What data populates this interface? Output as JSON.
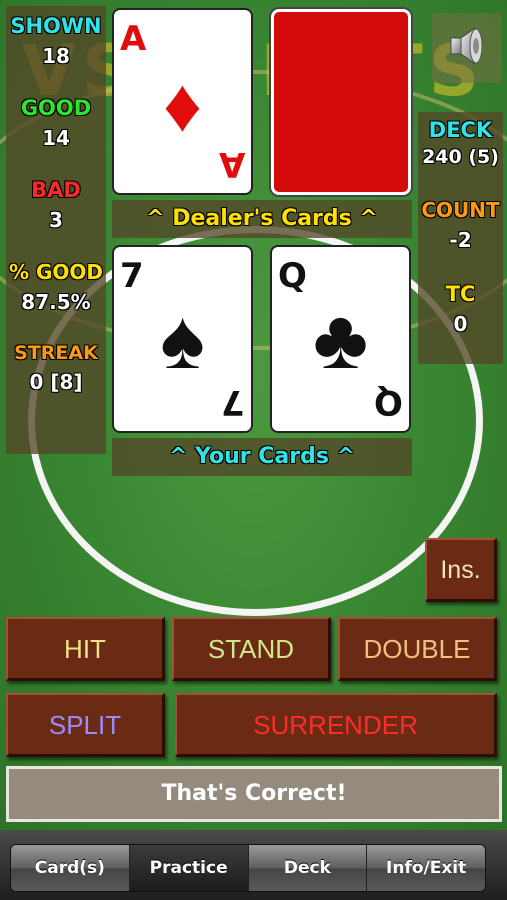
{
  "stats": {
    "shown": {
      "label": "SHOWN",
      "value": "18"
    },
    "good": {
      "label": "GOOD",
      "value": "14"
    },
    "bad": {
      "label": "BAD",
      "value": "3"
    },
    "pct_good": {
      "label": "% GOOD",
      "value": "87.5%"
    },
    "streak": {
      "label": "STREAK",
      "value": "0 [8]"
    }
  },
  "counts": {
    "deck": {
      "label": "DECK",
      "value": "240 (5)"
    },
    "count": {
      "label": "COUNT",
      "value": "-2"
    },
    "tc": {
      "label": "TC",
      "value": "0"
    }
  },
  "dealer": {
    "label": "^  Dealer's Cards  ^",
    "up_card": {
      "rank": "A",
      "suit": "♦",
      "color": "#e10d0d"
    },
    "hole_card": {
      "face": "down",
      "back_color": "#d40b0b"
    }
  },
  "player": {
    "label": "^  Your Cards  ^",
    "cards": [
      {
        "rank": "7",
        "suit": "♠",
        "color": "#111111"
      },
      {
        "rank": "Q",
        "suit": "♣",
        "color": "#111111"
      }
    ]
  },
  "buttons": {
    "insurance": "Ins.",
    "hit": "HIT",
    "stand": "STAND",
    "double": "DOUBLE",
    "split": "SPLIT",
    "surrender": "SURRENDER"
  },
  "status": "That's Correct!",
  "tabs": [
    {
      "label": "Card(s)",
      "active": false
    },
    {
      "label": "Practice",
      "active": true
    },
    {
      "label": "Deck",
      "active": false
    },
    {
      "label": "Info/Exit",
      "active": false
    }
  ],
  "icons": {
    "sound": "speaker-icon"
  },
  "colors": {
    "felt": "#3a8833",
    "button": "#6b2a14",
    "hit_text": "#f2e08a",
    "stand_text": "#cfe88a",
    "double_text": "#f0c080",
    "split_text": "#9a8cff",
    "surrender_text": "#ff2a2a",
    "ins_text": "#f2e6b8"
  }
}
